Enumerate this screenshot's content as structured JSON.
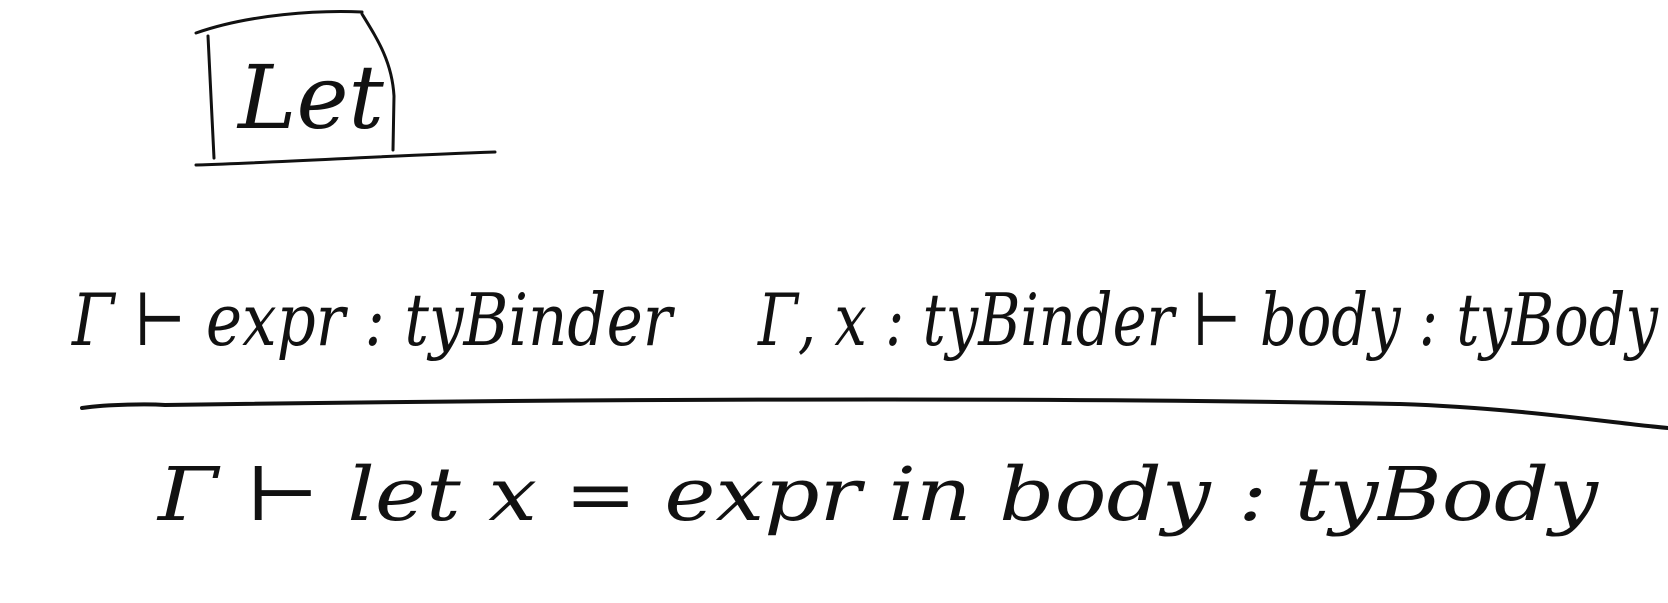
{
  "rule": {
    "name": "Let",
    "premises": [
      "Γ ⊢ expr : tyBinder",
      "Γ, x : tyBinder ⊢ body : tyBody"
    ],
    "conclusion": "Γ ⊢ let x = expr in body : tyBody"
  },
  "style": {
    "ink": "#111111",
    "background": "#ffffff"
  }
}
